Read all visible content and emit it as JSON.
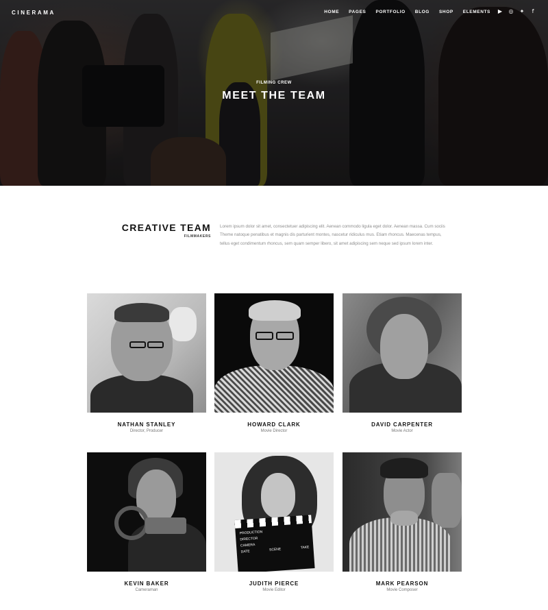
{
  "header": {
    "logo": "CINERAMA",
    "nav": [
      "HOME",
      "PAGES",
      "PORTFOLIO",
      "BLOG",
      "SHOP",
      "ELEMENTS"
    ],
    "social_icons": [
      "youtube-icon",
      "instagram-icon",
      "twitter-icon",
      "facebook-icon"
    ]
  },
  "hero": {
    "subtitle": "FILMING CREW",
    "title": "MEET THE TEAM"
  },
  "intro": {
    "title": "CREATIVE TEAM",
    "subtitle": "FILMMAKERS",
    "text": "Lorem ipsum dolor sit amet, consectetuer adipiscing elit. Aenean commodo ligula eget dolor. Aenean massa. Cum sociis Theme natoque penatibus et magnis dis parturient montes, nascetur ridiculus mus. Etiam rhoncus. Maecenas tempus, tellus eget condimentum rhoncus, sem quam semper libero, sit amet adipiscing sem neque sed ipsum lorem inter."
  },
  "team": [
    {
      "name": "NATHAN STANLEY",
      "role": "Director, Producer"
    },
    {
      "name": "HOWARD CLARK",
      "role": "Movie Director"
    },
    {
      "name": "DAVID CARPENTER",
      "role": "Movie Actor"
    },
    {
      "name": "KEVIN BAKER",
      "role": "Cameraman"
    },
    {
      "name": "JUDITH PIERCE",
      "role": "Movie Editor"
    },
    {
      "name": "MARK PEARSON",
      "role": "Movie Composer"
    }
  ],
  "clapperboard": [
    "PRODUCTION",
    "DIRECTOR",
    "CAMERA",
    "DATE",
    "SCENE",
    "TAKE"
  ]
}
